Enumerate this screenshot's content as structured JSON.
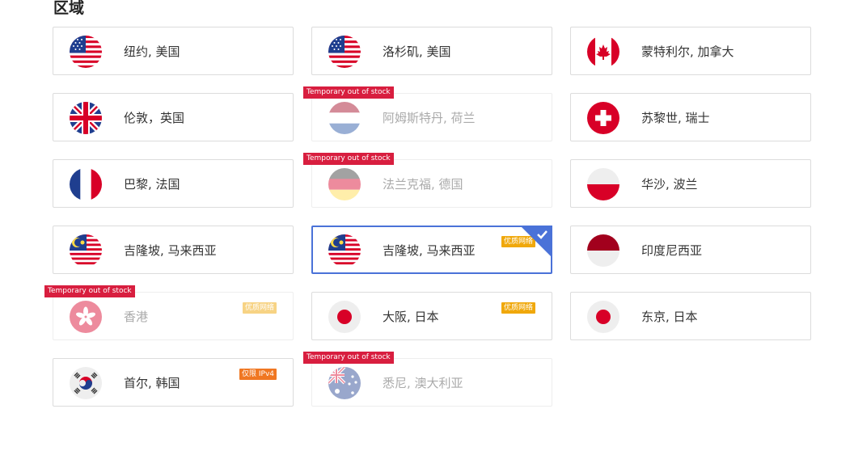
{
  "section_title": "区域",
  "out_of_stock_label": "Temporary out of stock",
  "regions": [
    {
      "id": "newyork",
      "label": "纽约, 美国",
      "flag": "us-flag-icon",
      "disabled": false,
      "selected": false,
      "badge": null
    },
    {
      "id": "losangeles",
      "label": "洛杉矶, 美国",
      "flag": "us-flag-icon",
      "disabled": false,
      "selected": false,
      "badge": null
    },
    {
      "id": "montreal",
      "label": "蒙特利尔, 加拿大",
      "flag": "ca-flag-icon",
      "disabled": false,
      "selected": false,
      "badge": null
    },
    {
      "id": "london",
      "label": "伦敦，英国",
      "flag": "uk-flag-icon",
      "disabled": false,
      "selected": false,
      "badge": null
    },
    {
      "id": "amsterdam",
      "label": "阿姆斯特丹, 荷兰",
      "flag": "nl-flag-icon",
      "disabled": true,
      "selected": false,
      "badge": null
    },
    {
      "id": "zurich",
      "label": "苏黎世, 瑞士",
      "flag": "ch-flag-icon",
      "disabled": false,
      "selected": false,
      "badge": null
    },
    {
      "id": "paris",
      "label": "巴黎, 法国",
      "flag": "fr-flag-icon",
      "disabled": false,
      "selected": false,
      "badge": null
    },
    {
      "id": "frankfurt",
      "label": "法兰克福, 德国",
      "flag": "de-flag-icon",
      "disabled": true,
      "selected": false,
      "badge": null
    },
    {
      "id": "warsaw",
      "label": "华沙, 波兰",
      "flag": "pl-flag-icon",
      "disabled": false,
      "selected": false,
      "badge": null
    },
    {
      "id": "kualalumpur1",
      "label": "吉隆坡, 马来西亚",
      "flag": "my-flag-icon",
      "disabled": false,
      "selected": false,
      "badge": null
    },
    {
      "id": "kualalumpur2",
      "label": "吉隆坡, 马来西亚",
      "flag": "my-flag-icon",
      "disabled": false,
      "selected": true,
      "badge": "优质网络"
    },
    {
      "id": "indonesia",
      "label": "印度尼西亚",
      "flag": "id-flag-icon",
      "disabled": false,
      "selected": false,
      "badge": null
    },
    {
      "id": "hongkong",
      "label": "香港",
      "flag": "hk-flag-icon",
      "disabled": true,
      "selected": false,
      "badge": "优质网络"
    },
    {
      "id": "osaka",
      "label": "大阪, 日本",
      "flag": "jp-flag-icon",
      "disabled": false,
      "selected": false,
      "badge": "优质网络"
    },
    {
      "id": "tokyo",
      "label": "东京, 日本",
      "flag": "jp-flag-icon",
      "disabled": false,
      "selected": false,
      "badge": null
    },
    {
      "id": "seoul",
      "label": "首尔, 韩国",
      "flag": "kr-flag-icon",
      "disabled": false,
      "selected": false,
      "badge": "仅限 IPv4"
    },
    {
      "id": "sydney",
      "label": "悉尼, 澳大利亚",
      "flag": "au-flag-icon",
      "disabled": true,
      "selected": false,
      "badge": null
    }
  ]
}
